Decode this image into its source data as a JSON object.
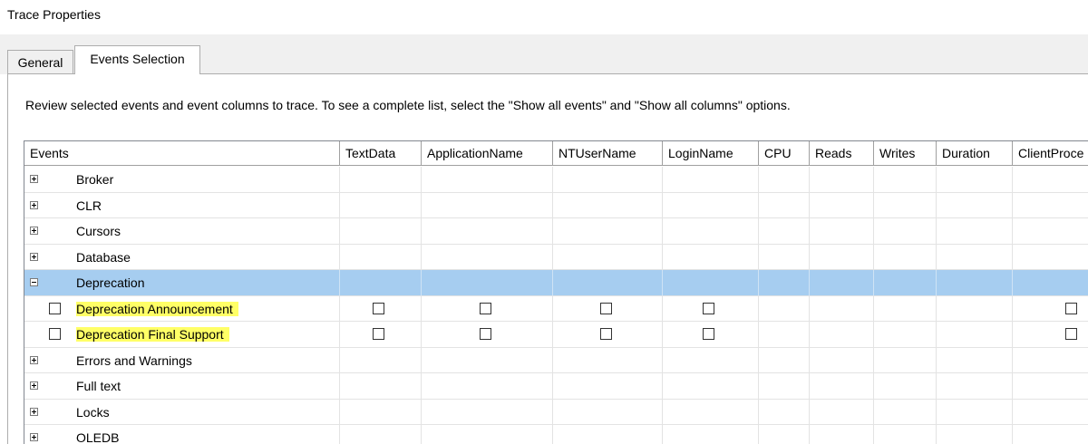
{
  "window": {
    "title": "Trace Properties"
  },
  "tabs": [
    {
      "label": "General",
      "active": false
    },
    {
      "label": "Events Selection",
      "active": true
    }
  ],
  "instructions": "Review selected events and event columns to trace. To see a complete list, select the \"Show all events\" and \"Show all columns\" options.",
  "grid": {
    "columns": [
      "Events",
      "TextData",
      "ApplicationName",
      "NTUserName",
      "LoginName",
      "CPU",
      "Reads",
      "Writes",
      "Duration",
      "ClientProce"
    ],
    "rows": [
      {
        "label": "Broker",
        "type": "category",
        "expanded": false
      },
      {
        "label": "CLR",
        "type": "category",
        "expanded": false
      },
      {
        "label": "Cursors",
        "type": "category",
        "expanded": false
      },
      {
        "label": "Database",
        "type": "category",
        "expanded": false
      },
      {
        "label": "Deprecation",
        "type": "category",
        "expanded": true,
        "selected": true
      },
      {
        "label": "Deprecation Announcement",
        "type": "event",
        "highlighted": true,
        "checked": false,
        "column_checkboxes": [
          "TextData",
          "ApplicationName",
          "NTUserName",
          "LoginName",
          "ClientProce"
        ]
      },
      {
        "label": "Deprecation Final Support",
        "type": "event",
        "highlighted": true,
        "checked": false,
        "column_checkboxes": [
          "TextData",
          "ApplicationName",
          "NTUserName",
          "LoginName",
          "ClientProce"
        ]
      },
      {
        "label": "Errors and Warnings",
        "type": "category",
        "expanded": false
      },
      {
        "label": "Full text",
        "type": "category",
        "expanded": false
      },
      {
        "label": "Locks",
        "type": "category",
        "expanded": false
      },
      {
        "label": "OLEDB",
        "type": "category",
        "expanded": false
      }
    ]
  },
  "colors": {
    "selected_row": "#a6cdf0",
    "highlight": "#ffff66",
    "tab_background": "#f0f0f0"
  }
}
